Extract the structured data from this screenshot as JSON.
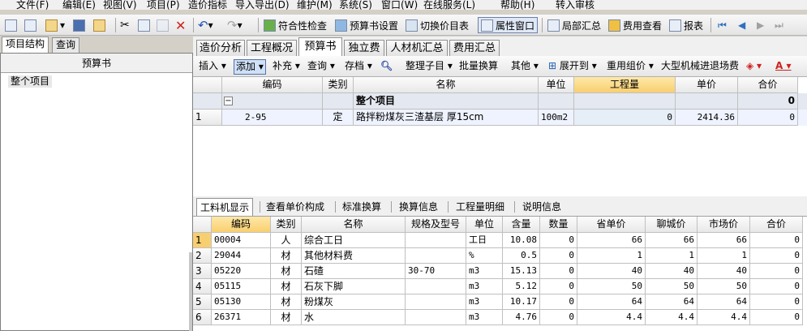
{
  "menu": [
    "文件(F)",
    "编辑(E)",
    "视图(V)",
    "项目(P)",
    "造价指标",
    "导入导出(D)",
    "维护(M)",
    "系统(S)",
    "窗口(W)",
    "在线服务(L)",
    "帮助(H)",
    "转入审核"
  ],
  "toolbar": {
    "check": "符合性检查",
    "budget_settings": "预算书设置",
    "switch_price": "切换价目表",
    "property_window": "属性窗口",
    "local_summary": "局部汇总",
    "fee_view": "费用查看",
    "report": "报表"
  },
  "left": {
    "tabs": [
      "项目结构",
      "查询"
    ],
    "header": "预算书",
    "items": [
      "整个项目"
    ]
  },
  "main_tabs": [
    "造价分析",
    "工程概况",
    "预算书",
    "独立费",
    "人材机汇总",
    "费用汇总"
  ],
  "main_toolbar": [
    "插入",
    "添加",
    "补充",
    "查询",
    "存档",
    "整理子目",
    "批量换算",
    "其他",
    "展开到",
    "重用组价",
    "大型机械进退场费"
  ],
  "budget_grid": {
    "columns": [
      "编码",
      "类别",
      "名称",
      "单位",
      "工程量",
      "单价",
      "合价"
    ],
    "group_row": {
      "name": "整个项目",
      "total": "0"
    },
    "rows": [
      {
        "idx": "1",
        "code": "2-95",
        "cat": "定",
        "name": "路拌粉煤灰三渣基层 厚15cm",
        "unit": "100m2",
        "qty": "0",
        "price": "2414.36",
        "total": "0"
      }
    ]
  },
  "bottom_tabs": [
    "工料机显示",
    "查看单价构成",
    "标准换算",
    "换算信息",
    "工程量明细",
    "说明信息"
  ],
  "resource_grid": {
    "columns": [
      "编码",
      "类别",
      "名称",
      "规格及型号",
      "单位",
      "含量",
      "数量",
      "省单价",
      "聊城价",
      "市场价",
      "合价"
    ],
    "rows": [
      {
        "idx": "1",
        "code": "00004",
        "cat": "人",
        "name": "综合工日",
        "spec": "",
        "unit": "工日",
        "content": "10.08",
        "qty": "0",
        "prov": "66",
        "lc": "66",
        "mkt": "66",
        "total": "0"
      },
      {
        "idx": "2",
        "code": "29044",
        "cat": "材",
        "name": "其他材料费",
        "spec": "",
        "unit": "%",
        "content": "0.5",
        "qty": "0",
        "prov": "1",
        "lc": "1",
        "mkt": "1",
        "total": "0"
      },
      {
        "idx": "3",
        "code": "05220",
        "cat": "材",
        "name": "石碴",
        "spec": "30-70",
        "unit": "m3",
        "content": "15.13",
        "qty": "0",
        "prov": "40",
        "lc": "40",
        "mkt": "40",
        "total": "0"
      },
      {
        "idx": "4",
        "code": "05115",
        "cat": "材",
        "name": "石灰下脚",
        "spec": "",
        "unit": "m3",
        "content": "5.12",
        "qty": "0",
        "prov": "50",
        "lc": "50",
        "mkt": "50",
        "total": "0"
      },
      {
        "idx": "5",
        "code": "05130",
        "cat": "材",
        "name": "粉煤灰",
        "spec": "",
        "unit": "m3",
        "content": "10.17",
        "qty": "0",
        "prov": "64",
        "lc": "64",
        "mkt": "64",
        "total": "0"
      },
      {
        "idx": "6",
        "code": "26371",
        "cat": "材",
        "name": "水",
        "spec": "",
        "unit": "m3",
        "content": "4.76",
        "qty": "0",
        "prov": "4.4",
        "lc": "4.4",
        "mkt": "4.4",
        "total": "0"
      }
    ]
  }
}
